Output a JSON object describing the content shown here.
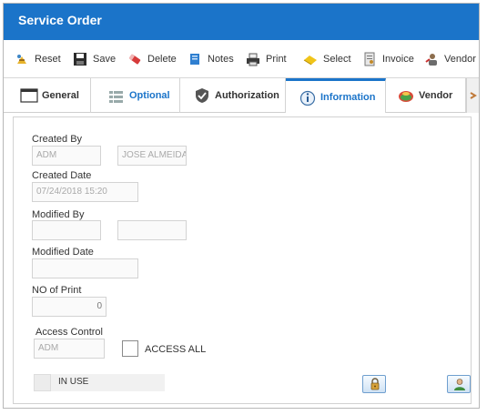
{
  "window": {
    "title": "Service Order"
  },
  "toolbar": {
    "reset": {
      "label": "Reset",
      "icon": "reset-icon"
    },
    "save": {
      "label": "Save",
      "icon": "save-icon"
    },
    "delete": {
      "label": "Delete",
      "icon": "delete-icon"
    },
    "notes": {
      "label": "Notes",
      "icon": "notes-icon"
    },
    "print": {
      "label": "Print",
      "icon": "print-icon"
    },
    "select": {
      "label": "Select",
      "icon": "select-icon"
    },
    "invoice": {
      "label": "Invoice",
      "icon": "invoice-icon"
    },
    "vendor": {
      "label": "Vendor R",
      "icon": "vendor-icon"
    }
  },
  "tabs": {
    "general": "General",
    "optional": "Optional",
    "authorization": "Authorization",
    "information": "Information",
    "vendor": "Vendor",
    "active": "Information"
  },
  "form": {
    "created_by": {
      "label": "Created By",
      "code": "ADM",
      "name": "JOSE ALMEIDA"
    },
    "created_date": {
      "label": "Created Date",
      "value": "07/24/2018 15:20"
    },
    "modified_by": {
      "label": "Modified By",
      "code": "",
      "name": ""
    },
    "modified_date": {
      "label": "Modified Date",
      "value": ""
    },
    "no_of_print": {
      "label": "NO of Print",
      "value": "0"
    },
    "access_control": {
      "label": "Access Control",
      "value": "ADM",
      "access_all_label": "ACCESS ALL",
      "access_all_checked": false
    },
    "in_use": {
      "label": "IN USE",
      "checked": false
    }
  },
  "colors": {
    "accent": "#1b74c9",
    "title_text": "#ffffff"
  }
}
